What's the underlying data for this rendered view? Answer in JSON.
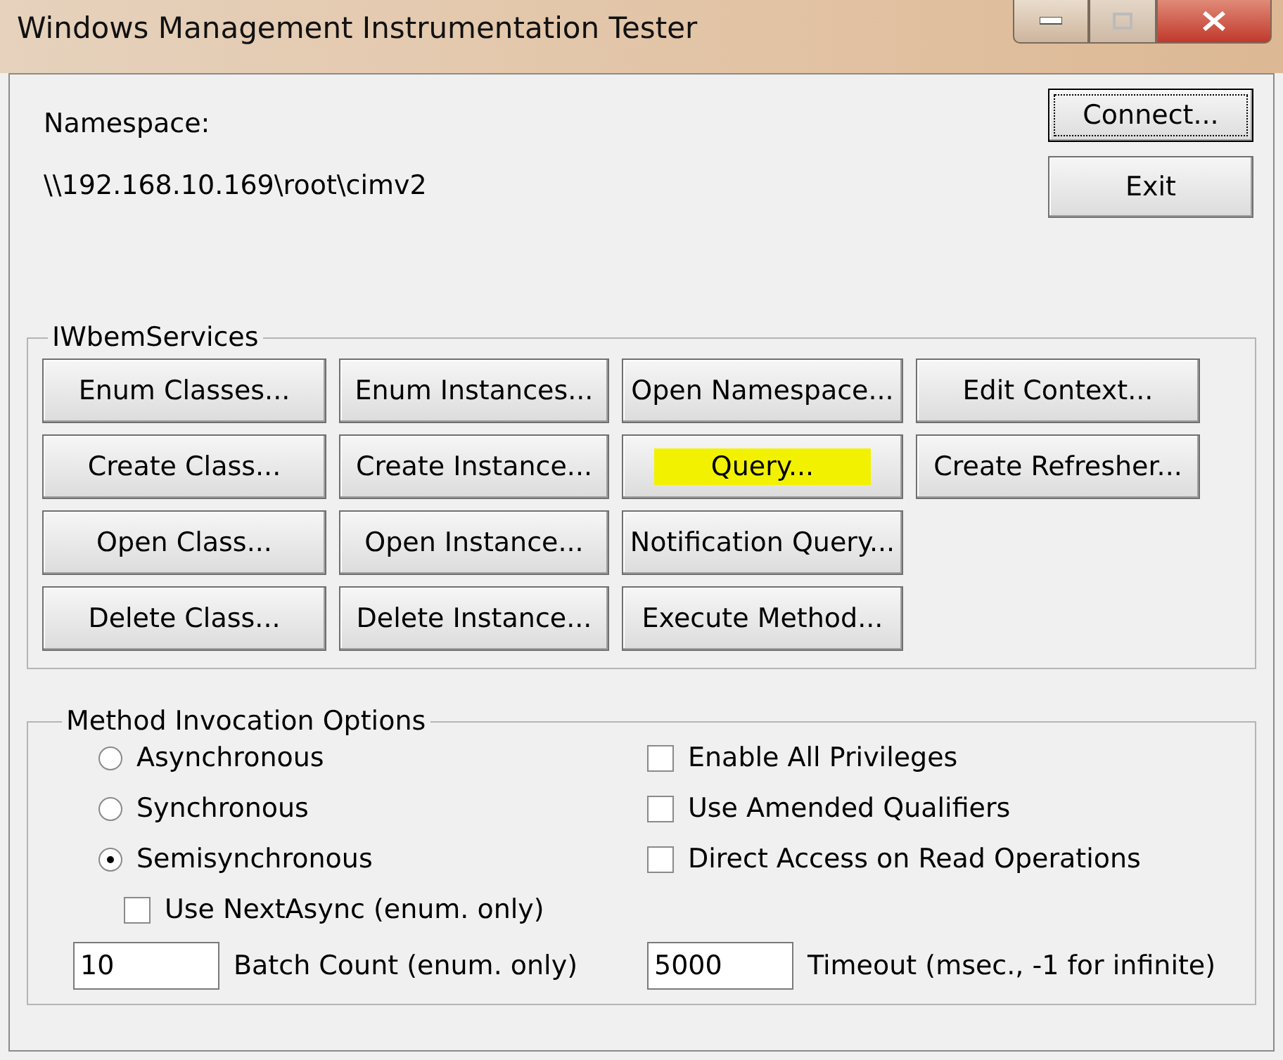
{
  "window": {
    "title": "Windows Management Instrumentation Tester"
  },
  "namespace": {
    "label": "Namespace:",
    "value": "\\\\192.168.10.169\\root\\cimv2"
  },
  "side_buttons": [
    {
      "label": "Connect...",
      "focused": true
    },
    {
      "label": "Exit",
      "focused": false
    }
  ],
  "services": {
    "title": "IWbemServices",
    "rows": [
      [
        {
          "label": "Enum Classes...",
          "highlighted": false
        },
        {
          "label": "Enum Instances...",
          "highlighted": false
        },
        {
          "label": "Open Namespace...",
          "highlighted": false
        },
        {
          "label": "Edit Context...",
          "highlighted": false
        }
      ],
      [
        {
          "label": "Create Class...",
          "highlighted": false
        },
        {
          "label": "Create Instance...",
          "highlighted": false
        },
        {
          "label": "Query...",
          "highlighted": true
        },
        {
          "label": "Create Refresher...",
          "highlighted": false
        }
      ],
      [
        {
          "label": "Open Class...",
          "highlighted": false
        },
        {
          "label": "Open Instance...",
          "highlighted": false
        },
        {
          "label": "Notification Query...",
          "highlighted": false
        }
      ],
      [
        {
          "label": "Delete Class...",
          "highlighted": false
        },
        {
          "label": "Delete Instance...",
          "highlighted": false
        },
        {
          "label": "Execute Method...",
          "highlighted": false
        }
      ]
    ]
  },
  "options": {
    "title": "Method Invocation Options",
    "modes": [
      {
        "label": "Asynchronous",
        "selected": false
      },
      {
        "label": "Synchronous",
        "selected": false
      },
      {
        "label": "Semisynchronous",
        "selected": true
      }
    ],
    "flags": [
      {
        "label": "Enable All Privileges",
        "checked": false
      },
      {
        "label": "Use Amended Qualifiers",
        "checked": false
      },
      {
        "label": "Direct Access on Read Operations",
        "checked": false
      }
    ],
    "next_async": {
      "label": "Use NextAsync (enum. only)",
      "checked": false
    },
    "batch_count": {
      "value": "10",
      "label": "Batch Count (enum. only)"
    },
    "timeout": {
      "value": "5000",
      "label": "Timeout (msec., -1 for infinite)"
    }
  }
}
